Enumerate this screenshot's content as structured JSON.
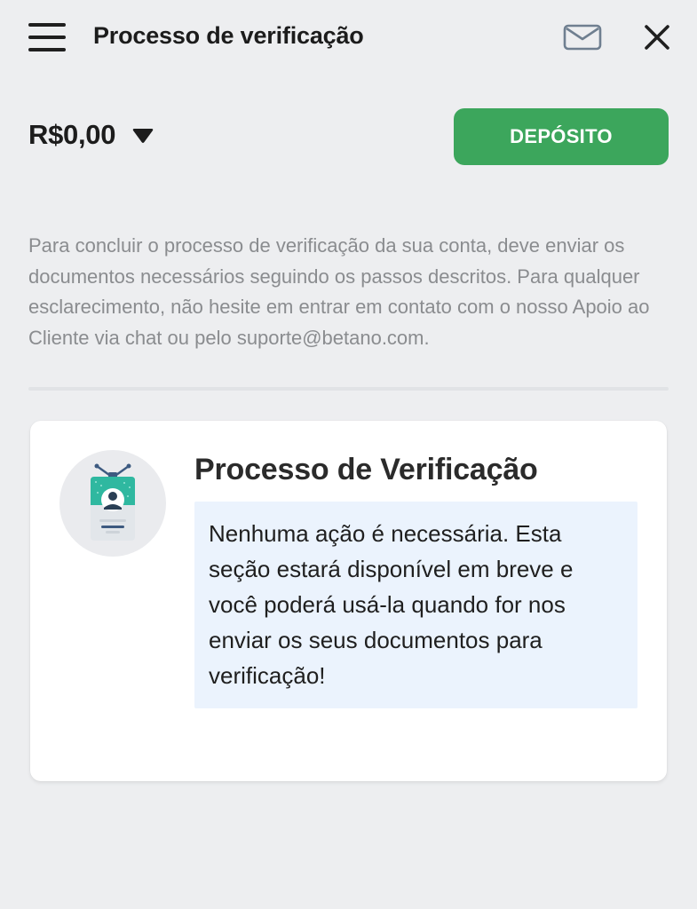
{
  "header": {
    "title": "Processo de verificação"
  },
  "balance": {
    "amount": "R$0,00"
  },
  "deposit": {
    "label": "DEPÓSITO"
  },
  "intro": {
    "text": "Para concluir o processo de verificação da sua conta, deve enviar os documentos necessários seguindo os passos descritos. Para qualquer esclarecimento, não hesite em entrar em contato com o nosso Apoio ao Cliente via chat ou pelo suporte@betano.com."
  },
  "card": {
    "title": "Processo de Verificação",
    "icon": "id-badge-icon",
    "notice": "Nenhuma ação é necessária. Esta seção estará disponível em breve e você poderá usá-la quando for nos enviar os seus documentos para verificação!"
  },
  "icons": {
    "menu": "hamburger-menu-icon",
    "mail": "mail-icon",
    "close": "close-icon",
    "balance_toggle": "caret-down-icon"
  },
  "colors": {
    "background": "#edeef0",
    "accent_green": "#3ca65c",
    "notice_background": "#ebf3fd",
    "muted_text": "#8a8c8f",
    "icon_teal": "#2fb8a0"
  }
}
